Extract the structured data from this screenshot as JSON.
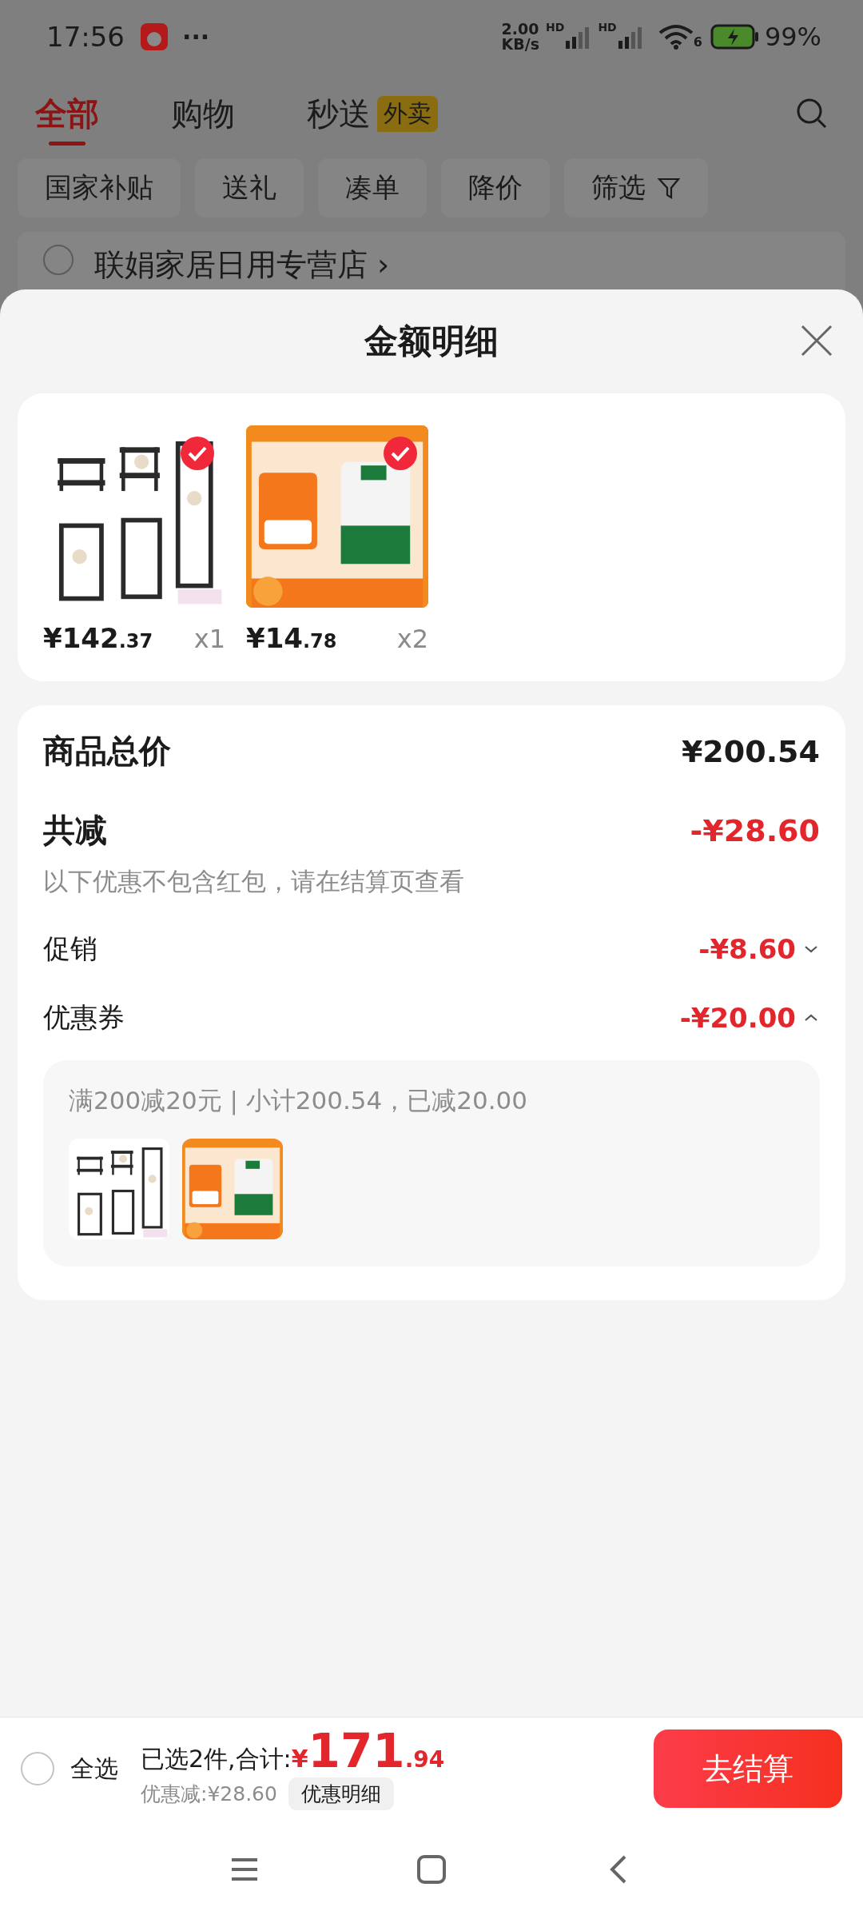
{
  "status_bar": {
    "time": "17:56",
    "more": "···",
    "speed_value": "2.00",
    "speed_unit": "KB/s",
    "sim_labels": [
      "HD",
      "HD"
    ],
    "wifi_label": "6",
    "battery": "99%"
  },
  "tabs": [
    {
      "label": "全部",
      "selected": true
    },
    {
      "label": "购物",
      "selected": false
    },
    {
      "label": "秒送",
      "selected": false,
      "badge": "外卖"
    }
  ],
  "filter_chips": [
    {
      "label": "国家补贴",
      "kind": "plain"
    },
    {
      "label": "送礼",
      "kind": "plain"
    },
    {
      "label": "凑单",
      "kind": "plain"
    },
    {
      "label": "降价",
      "kind": "plain"
    },
    {
      "label": "筛选",
      "kind": "filter"
    }
  ],
  "store": {
    "name": "联娟家居日用专营店",
    "chevron": "›",
    "checked": false
  },
  "sheet": {
    "title": "金额明细",
    "products": [
      {
        "kind": "picture",
        "price_main": "¥142",
        "price_decimal": ".37",
        "quantity": "x1",
        "checked": true
      },
      {
        "kind": "picture",
        "price_main": "¥14",
        "price_decimal": ".78",
        "quantity": "x2",
        "checked": true
      }
    ],
    "total": {
      "label": "商品总价",
      "amount": "¥200.54"
    },
    "discount": {
      "label": "共减",
      "amount": "-¥28.60",
      "note": "以下优惠不包含红包，请在结算页查看"
    },
    "promotions": [
      {
        "label": "促销",
        "amount": "-¥8.60",
        "expanded": false
      },
      {
        "label": "优惠券",
        "amount": "-¥20.00",
        "expanded": true
      }
    ],
    "coupon_detail": {
      "text": "满200减20元 | 小计200.54，已减20.00"
    }
  },
  "footer": {
    "select_all": {
      "label": "全选",
      "checked": false
    },
    "selected_text": "已选2件,合计:",
    "currency": "¥",
    "total_main": "171",
    "total_decimal": ".94",
    "saved": "优惠减:¥28.60",
    "detail_button": "优惠明细",
    "checkout_button": "去结算"
  }
}
